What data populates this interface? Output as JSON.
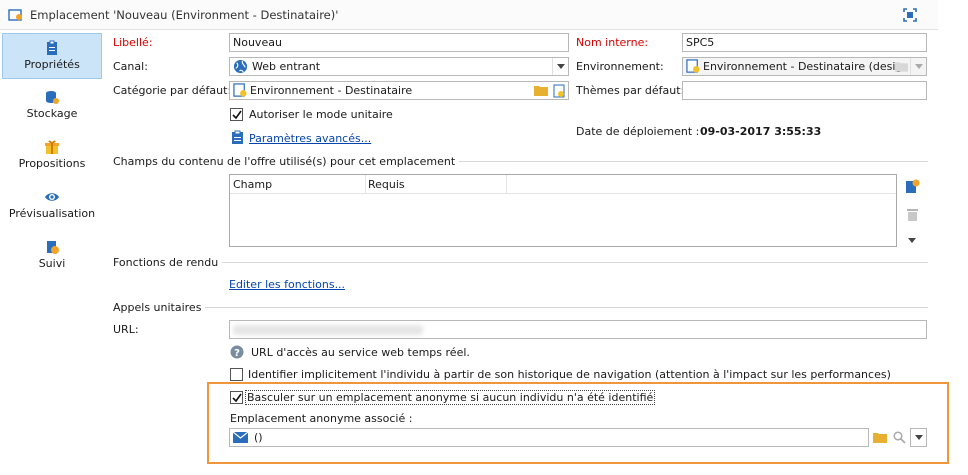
{
  "window": {
    "title": "Emplacement 'Nouveau (Environment - Destinataire)'"
  },
  "sidebar": {
    "items": [
      {
        "label": "Propriétés",
        "icon": "clipboard-icon",
        "active": true
      },
      {
        "label": "Stockage",
        "icon": "database-icon"
      },
      {
        "label": "Propositions",
        "icon": "gift-icon"
      },
      {
        "label": "Prévisualisation",
        "icon": "eye-icon"
      },
      {
        "label": "Suivi",
        "icon": "tracking-icon"
      }
    ]
  },
  "form": {
    "libelle_label": "Libellé:",
    "libelle_value": "Nouveau",
    "nom_interne_label": "Nom interne:",
    "nom_interne_value": "SPC5",
    "canal_label": "Canal:",
    "canal_value": "Web entrant",
    "environnement_label": "Environnement:",
    "environnement_value": "Environnement - Destinataire (desig",
    "categorie_label": "Catégorie par défaut:",
    "categorie_value": "Environnement - Destinataire",
    "themes_label": "Thèmes par défaut:",
    "themes_value": "",
    "autoriser_label": "Autoriser le mode unitaire",
    "parametres_link": "Paramètres avancés...",
    "date_label": "Date de déploiement :",
    "date_value": "09-03-2017 3:55:33"
  },
  "champs": {
    "section_title": "Champs du contenu de l'offre utilisé(s) pour cet emplacement",
    "columns": [
      "Champ",
      "Requis"
    ]
  },
  "fonctions": {
    "section_title": "Fonctions de rendu",
    "link": "Editer les fonctions..."
  },
  "appels": {
    "section_title": "Appels unitaires",
    "url_label": "URL:",
    "url_help": "URL d'accès au service web temps réel.",
    "identifier_label": "Identifier implicitement l'individu à partir de son historique de navigation (attention à l'impact sur les performances)",
    "basculer_label": "Basculer sur un emplacement anonyme si aucun individu n'a été identifié",
    "anonyme_label": "Emplacement anonyme associé :",
    "anonyme_value": "()"
  },
  "colors": {
    "accent": "#f0953a",
    "link": "#0645ad",
    "required": "#d40000",
    "selected": "#cce4f7"
  }
}
